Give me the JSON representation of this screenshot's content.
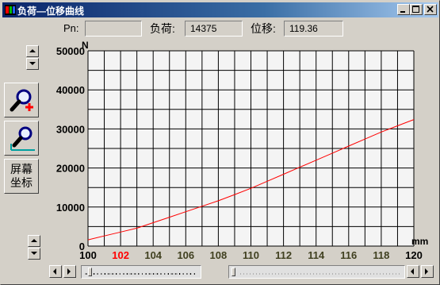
{
  "window": {
    "title": "负荷—位移曲线"
  },
  "readouts": {
    "pn_label": "Pn:",
    "pn_value": "",
    "load_label": "负荷:",
    "load_value": "14375",
    "disp_label": "位移:",
    "disp_value": "119.36"
  },
  "tools": {
    "screen_coords_label_line1": "屏幕",
    "screen_coords_label_line2": "坐标"
  },
  "icons": {
    "app": "app-icon",
    "minimize": "minimize-icon",
    "maximize": "maximize-icon",
    "close": "close-icon",
    "zoom_in": "zoom-in-magnifier-icon",
    "zoom_reset": "zoom-reset-magnifier-icon"
  },
  "colors": {
    "curve": "#ff0000",
    "highlight_tick": "#ff0000",
    "x_tick": "#404020",
    "grid": "#000000"
  },
  "chart_data": {
    "type": "line",
    "xlabel": "mm",
    "ylabel": "N",
    "xlim": [
      100,
      120
    ],
    "ylim": [
      0,
      50000
    ],
    "x_ticks": [
      "100",
      "102",
      "104",
      "106",
      "108",
      "110",
      "112",
      "114",
      "116",
      "118",
      "120"
    ],
    "x_tick_highlight": "102",
    "y_ticks": [
      "0",
      "10000",
      "20000",
      "30000",
      "40000",
      "50000"
    ],
    "grid": true,
    "series": [
      {
        "x": [
          100,
          101,
          102,
          103,
          104,
          105,
          106,
          107,
          108,
          109,
          110,
          111,
          112,
          113,
          114,
          115,
          116,
          117,
          118,
          119,
          120
        ],
        "y": [
          1600,
          2600,
          3600,
          4600,
          6000,
          7400,
          8800,
          10200,
          11600,
          13200,
          14800,
          16600,
          18400,
          20200,
          22000,
          23800,
          25600,
          27400,
          29200,
          30800,
          32400
        ]
      }
    ]
  }
}
